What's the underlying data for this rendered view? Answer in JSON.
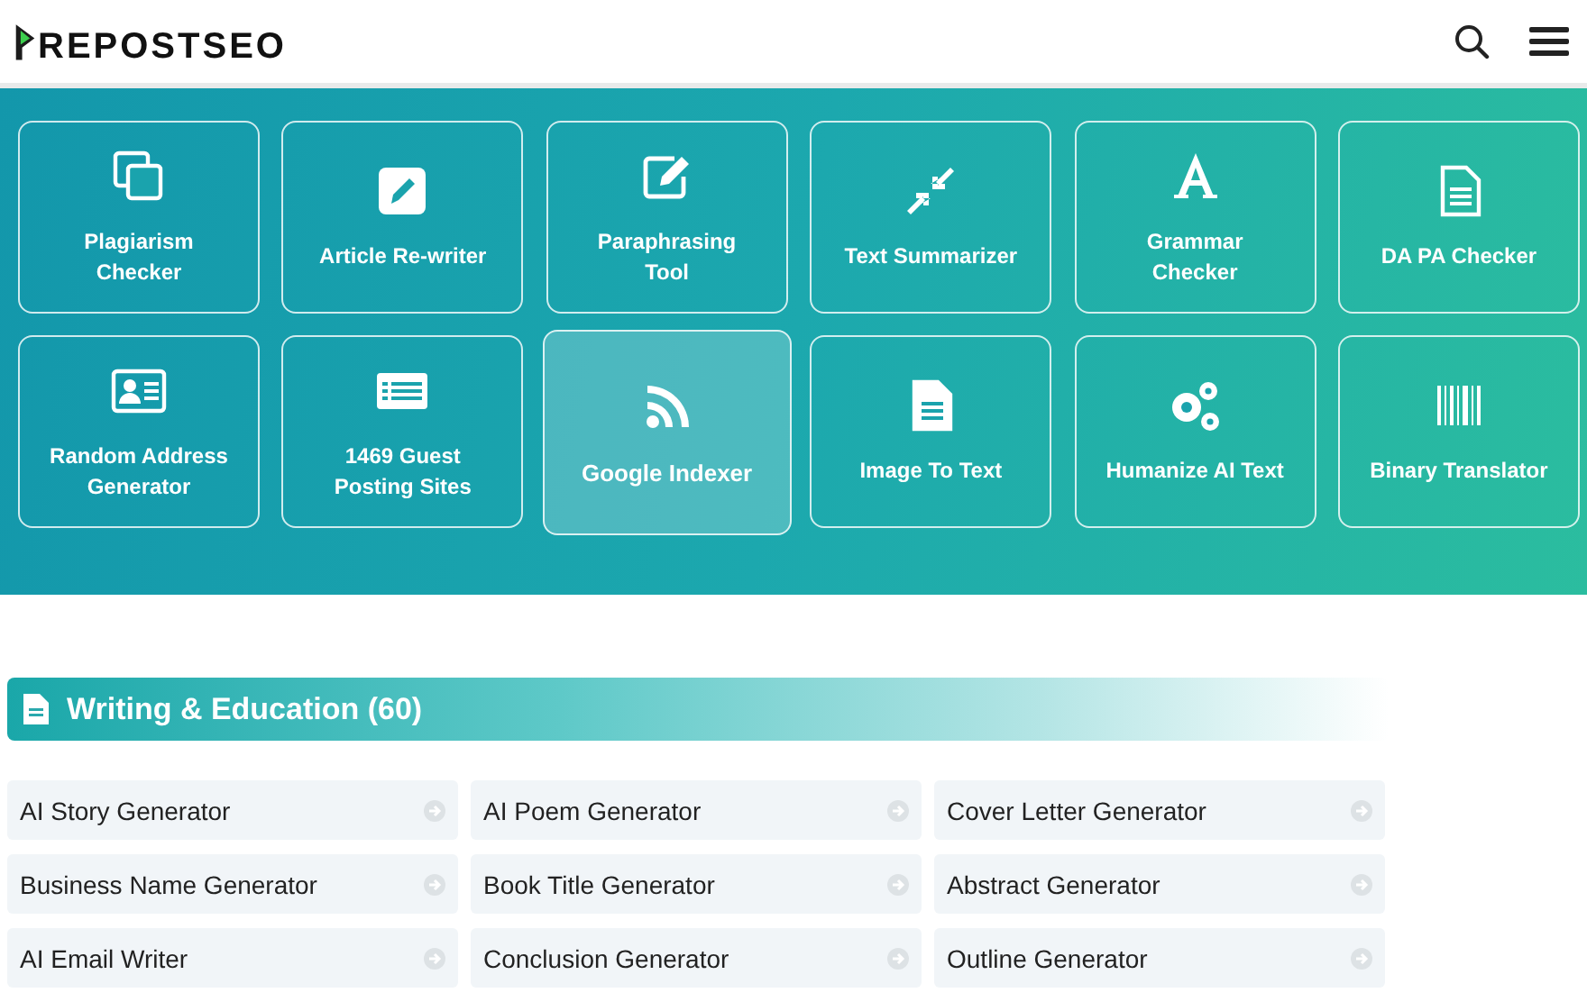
{
  "logo": {
    "text": "REPOSTSEO"
  },
  "tools": [
    {
      "label": "Plagiarism Checker",
      "selected": false
    },
    {
      "label": "Article Re-writer",
      "selected": false
    },
    {
      "label": "Paraphrasing Tool",
      "selected": false
    },
    {
      "label": "Text Summarizer",
      "selected": false
    },
    {
      "label": "Grammar Checker",
      "selected": false
    },
    {
      "label": "DA PA Checker",
      "selected": false
    },
    {
      "label": "Random Address Generator",
      "selected": false
    },
    {
      "label": "1469 Guest Posting Sites",
      "selected": false
    },
    {
      "label": "Google Indexer",
      "selected": true
    },
    {
      "label": "Image To Text",
      "selected": false
    },
    {
      "label": "Humanize AI Text",
      "selected": false
    },
    {
      "label": "Binary Translator",
      "selected": false
    }
  ],
  "section": {
    "title": "Writing & Education (60)",
    "items": [
      "AI Story Generator",
      "AI Poem Generator",
      "Cover Letter Generator",
      "Business Name Generator",
      "Book Title Generator",
      "Abstract Generator",
      "AI Email Writer",
      "Conclusion Generator",
      "Outline Generator"
    ]
  }
}
